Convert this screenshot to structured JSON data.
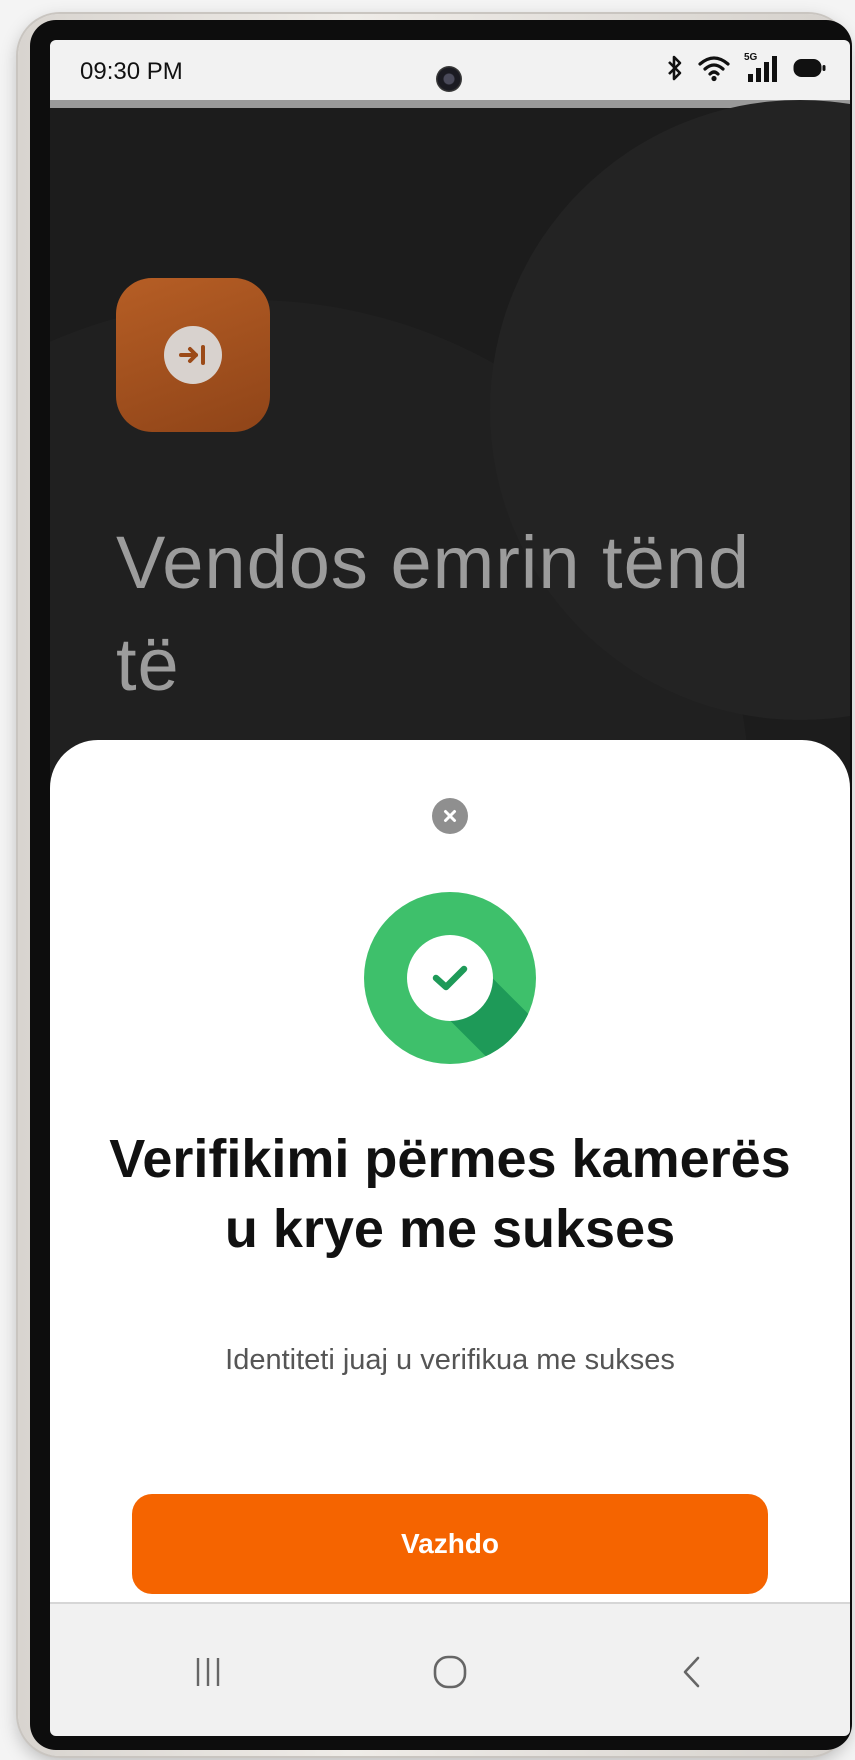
{
  "status_bar": {
    "time": "09:30 PM",
    "network_label": "5G",
    "icons": [
      "bluetooth-icon",
      "wifi-icon",
      "signal-icon",
      "battery-icon"
    ]
  },
  "background": {
    "logo_icon": "login-arrow-icon",
    "heading": "Vendos emrin tënd të"
  },
  "sheet": {
    "close_icon": "close-icon",
    "success_icon": "check-circle-icon",
    "title": "Verifikimi përmes kamerës u krye me sukses",
    "subtitle": "Identiteti juaj u verifikua me sukses",
    "button_label": "Vazhdo"
  },
  "nav_bar": {
    "icons": [
      "recent-apps-icon",
      "home-icon",
      "back-icon"
    ]
  },
  "colors": {
    "accent": "#f56400",
    "success": "#3ec06b",
    "logo": "#b65e25"
  }
}
